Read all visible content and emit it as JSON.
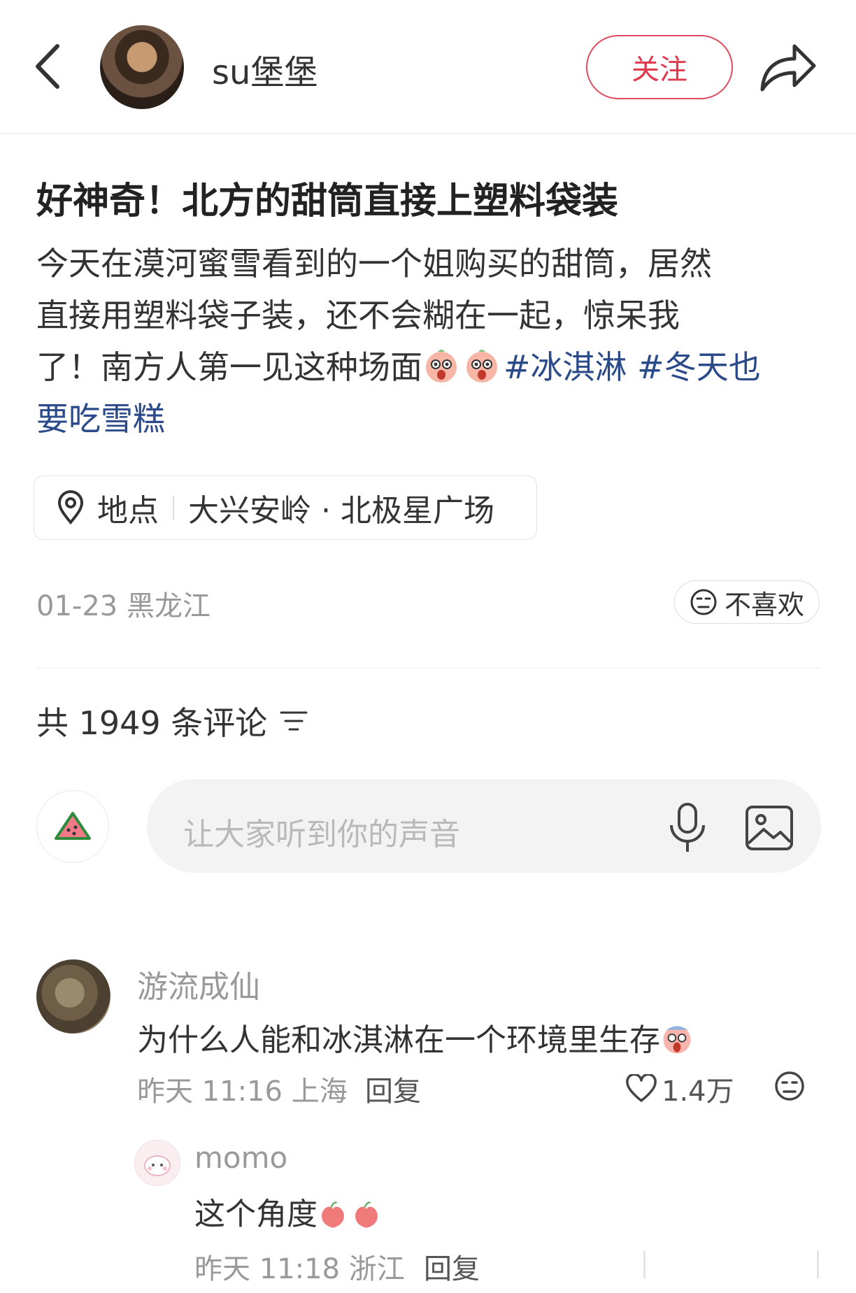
{
  "header": {
    "author_name": "su堡堡",
    "follow_label": "关注"
  },
  "post": {
    "title": "好神奇！北方的甜筒直接上塑料袋装",
    "body_line1": "今天在漠河蜜雪看到的一个姐购买的甜筒，居然",
    "body_line2": "直接用塑料袋子装，还不会糊在一起，惊呆我",
    "body_line3_text": "了！南方人第一见这种场面",
    "tag1": "#冰淇淋",
    "tag2_part1": "#冬天也",
    "tag2_part2": "要吃雪糕",
    "emoji_name": "surprised-peach-emoji",
    "location_label": "地点",
    "location_value": "大兴安岭 · 北极星广场",
    "date_region": "01-23 黑龙江",
    "dislike_label": "不喜欢"
  },
  "comments_section": {
    "count_label": "共 1949 条评论",
    "input_placeholder": "让大家听到你的声音"
  },
  "comments": [
    {
      "author": "游流成仙",
      "text": "为什么人能和冰淇淋在一个环境里生存",
      "time_region": "昨天 11:16 上海",
      "reply_label": "回复",
      "likes": "1.4万"
    },
    {
      "author": "momo",
      "text": "这个角度",
      "time_region": "昨天 11:18 浙江",
      "reply_label": "回复"
    }
  ],
  "colors": {
    "accent": "#e03a4f",
    "tag": "#2a4a8a",
    "muted": "#999999"
  }
}
